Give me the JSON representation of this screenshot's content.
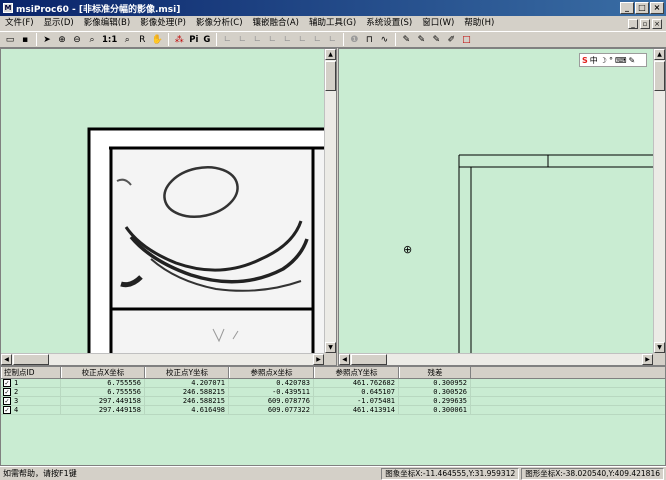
{
  "window": {
    "title": "msiProc60 - [非标准分幅的影像.msi]",
    "icon_text": "M"
  },
  "menu": [
    {
      "label": "文件(F)"
    },
    {
      "label": "显示(D)"
    },
    {
      "label": "影像编辑(B)"
    },
    {
      "label": "影像处理(P)"
    },
    {
      "label": "影像分析(C)"
    },
    {
      "label": "镶嵌融合(A)"
    },
    {
      "label": "辅助工具(G)"
    },
    {
      "label": "系统设置(S)"
    },
    {
      "label": "窗口(W)"
    },
    {
      "label": "帮助(H)"
    }
  ],
  "toolbar": {
    "zoom_actual": "1:1",
    "pi_label": "Pi",
    "g_label": "G"
  },
  "ime": {
    "logo": "S",
    "mode": "中"
  },
  "table": {
    "columns": [
      "控制点ID",
      "校正点X坐标",
      "校正点Y坐标",
      "参照点x坐标",
      "参照点Y坐标",
      "残差"
    ],
    "rows": [
      {
        "id": "1",
        "cx": "6.755556",
        "cy": "4.207071",
        "rx": "0.420783",
        "ry": "461.762682",
        "res": "0.300952"
      },
      {
        "id": "2",
        "cx": "6.755556",
        "cy": "246.588215",
        "rx": "-0.439511",
        "ry": "0.645107",
        "res": "0.300526"
      },
      {
        "id": "3",
        "cx": "297.449158",
        "cy": "246.588215",
        "rx": "609.078776",
        "ry": "-1.075481",
        "res": "0.299635"
      },
      {
        "id": "4",
        "cx": "297.449158",
        "cy": "4.616498",
        "rx": "609.077322",
        "ry": "461.413914",
        "res": "0.300061"
      }
    ]
  },
  "status": {
    "help": "如需帮助，请按F1键",
    "image_coord": "图象坐标X:-11.464555,Y:31.959312",
    "graphic_coord": "图形坐标X:-38.020540,Y:409.421816"
  }
}
